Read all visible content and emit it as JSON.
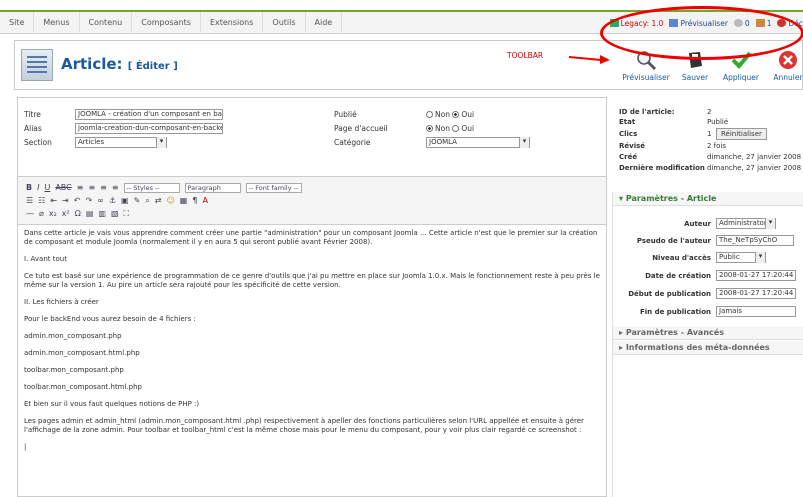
{
  "menu": {
    "items": [
      "Site",
      "Menus",
      "Contenu",
      "Composants",
      "Extensions",
      "Outils",
      "Aide"
    ]
  },
  "status": {
    "legacy": "Legacy: 1.0",
    "preview": "Prévisualiser",
    "count1": "0",
    "count2": "1",
    "logout": "Déc"
  },
  "header": {
    "title": "Article:",
    "subtitle": "[ Éditer ]"
  },
  "annotation": {
    "label": "TOOLBAR"
  },
  "toolbar": {
    "preview": "Prévisualiser",
    "save": "Sauver",
    "apply": "Appliquer",
    "cancel": "Annuler"
  },
  "form": {
    "title_label": "Titre",
    "title_value": "JOOMLA - création d'un composant en backe",
    "alias_label": "Alias",
    "alias_value": "joomla-creation-dun-composant-en-backend",
    "section_label": "Section",
    "section_value": "Articles",
    "published_label": "Publié",
    "frontpage_label": "Page d'accueil",
    "category_label": "Catégorie",
    "category_value": "JOOMLA",
    "non": "Non",
    "oui": "Oui"
  },
  "editor": {
    "styles": "-- Styles --",
    "paragraph": "Paragraph",
    "fontfamily": "-- Font family --",
    "paragraphs": [
      "Dans cette article je vais vous apprendre comment créer une partie \"administration\" pour un composant Joomla ... Cette article n'est que le premier sur la création de composant et module Joomla (normalement il y en aura 5 qui seront publié avant Février 2008).",
      "I. Avant tout",
      "Ce tuto est basé sur une expérience de programmation de ce genre d'outils que j'ai pu mettre en place sur Joomla 1.0.x. Mais le fonctionnement reste à peu près le même sur la version 1. Au pire un article sera rajouté pour les spécificité de cette version.",
      "II. Les fichiers à créer",
      "Pour le backEnd vous aurez besoin de 4 fichiers :",
      "admin.mon_composant.php",
      "admin.mon_composant.html.php",
      "toolbar.mon_composant.php",
      "toolbar.mon_composant.html.php",
      "Et bien sur il vous faut quelques notions de PHP :)",
      "Les pages admin et admin_html (admin.mon_composant.html .php) respectivement à apeller des fonctions particulières selon l'URL appellée et ensuite à gérer l'affichage de la zone admin. Pour toolbar et toolbar_html c'est la même chose mais pour le menu du composant, pour y voir plus clair regardé ce screenshot :"
    ]
  },
  "info": {
    "id_label": "ID de l'article:",
    "id_value": "2",
    "state_label": "Etat",
    "state_value": "Publié",
    "hits_label": "Clics",
    "hits_value": "1",
    "reset": "Réinitialiser",
    "revised_label": "Révisé",
    "revised_value": "2 fois",
    "created_label": "Créé",
    "created_value": "dimanche, 27 janvier 2008 17",
    "modified_label": "Dernière modification",
    "modified_value": "dimanche, 27 janvier 2008 17"
  },
  "params": {
    "header": "Paramètres - Article",
    "author_label": "Auteur",
    "author_value": "Administrator",
    "alias_label": "Pseudo de l'auteur",
    "alias_value": "The_NeTpSyChO",
    "access_label": "Niveau d'accès",
    "access_value": "Public",
    "created_label": "Date de création",
    "created_value": "2008-01-27 17:20:44",
    "pubstart_label": "Début de publication",
    "pubstart_value": "2008-01-27 17:20:44",
    "pubend_label": "Fin de publication",
    "pubend_value": "Jamais",
    "advanced": "Paramètres - Avancés",
    "meta": "Informations des méta-données"
  }
}
